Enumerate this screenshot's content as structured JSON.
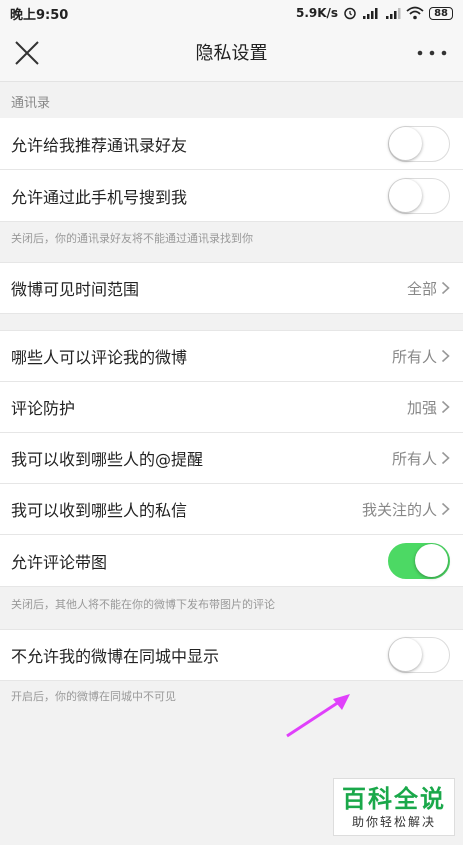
{
  "status_bar": {
    "time": "晚上9:50",
    "net_speed": "5.9K/s",
    "battery": "88",
    "icons": [
      "alarm-icon",
      "signal-hd-icon",
      "signal-icon",
      "wifi-icon",
      "battery-icon"
    ]
  },
  "nav": {
    "title": "隐私设置",
    "close_icon": "close-icon",
    "more_icon": "more-icon"
  },
  "sections": {
    "contacts_header": "通讯录",
    "contacts_note": "关闭后，你的通讯录好友将不能通过通讯录找到你",
    "comment_image_note": "关闭后，其他人将不能在你的微博下发布带图片的评论",
    "city_note": "开启后，你的微博在同城中不可见"
  },
  "rows": {
    "recommend_contacts": {
      "label": "允许给我推荐通讯录好友",
      "toggle": false
    },
    "find_by_phone": {
      "label": "允许通过此手机号搜到我",
      "toggle": false
    },
    "visible_range": {
      "label": "微博可见时间范围",
      "value": "全部"
    },
    "who_can_comment": {
      "label": "哪些人可以评论我的微博",
      "value": "所有人"
    },
    "comment_protect": {
      "label": "评论防护",
      "value": "加强"
    },
    "mention": {
      "label": "我可以收到哪些人的@提醒",
      "value": "所有人"
    },
    "private_msg": {
      "label": "我可以收到哪些人的私信",
      "value": "我关注的人"
    },
    "comment_image": {
      "label": "允许评论带图",
      "toggle": true
    },
    "hide_in_city": {
      "label": "不允许我的微博在同城中显示",
      "toggle": false
    }
  },
  "watermark": {
    "big": "百科全说",
    "small": "助你轻松解决"
  },
  "colors": {
    "toggle_on": "#4cd964",
    "arrow": "#e040fb",
    "watermark_green": "#1aa84a"
  }
}
